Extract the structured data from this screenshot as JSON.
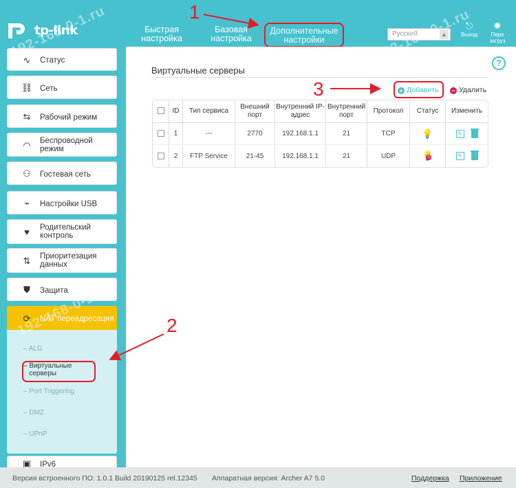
{
  "header": {
    "logo_text": "tp-link",
    "tabs": [
      {
        "label_line1": "Быстрая",
        "label_line2": "настройка"
      },
      {
        "label_line1": "Базовая",
        "label_line2": "настройка"
      },
      {
        "label_line1": "Дополнительные",
        "label_line2": "настройки"
      }
    ],
    "language": "Русский",
    "logout_label": "Выход",
    "reboot_label_line1": "Пере",
    "reboot_label_line2": "загруз"
  },
  "sidebar": {
    "items": [
      {
        "label": "Статус",
        "icon": "pulse-icon"
      },
      {
        "label": "Сеть",
        "icon": "network-icon"
      },
      {
        "label": "Рабочий режим",
        "icon": "mode-icon"
      },
      {
        "label_line1": "Беспроводной",
        "label_line2": "режим",
        "icon": "wifi-icon"
      },
      {
        "label": "Гостевая сеть",
        "icon": "guest-icon"
      },
      {
        "label": "Настройки USB",
        "icon": "usb-icon"
      },
      {
        "label_line1": "Родительский",
        "label_line2": "контроль",
        "icon": "heart-icon"
      },
      {
        "label_line1": "Приоритезация",
        "label_line2": "данных",
        "icon": "priority-icon"
      },
      {
        "label": "Защита",
        "icon": "shield-icon"
      },
      {
        "label": "NAT переадресация",
        "icon": "nat-icon"
      },
      {
        "label": "IPv6",
        "icon": "ipv6-icon"
      }
    ],
    "submenu": [
      {
        "label": "ALG"
      },
      {
        "label_line1": "Виртуальные",
        "label_line2": "серверы"
      },
      {
        "label": "Port Triggering"
      },
      {
        "label": "DMZ"
      },
      {
        "label": "UPnP"
      }
    ]
  },
  "main": {
    "title": "Виртуальные серверы",
    "add_label": "Добавить",
    "delete_label": "Удалить",
    "table": {
      "headers": [
        "ID",
        "Тип сервиса",
        "Внешний порт",
        "Внутренний IP-адрес",
        "Внутренний порт",
        "Протокол",
        "Статус",
        "Изменить"
      ],
      "header_lines": {
        "external_port": [
          "Внешний",
          "порт"
        ],
        "internal_ip": [
          "Внутренний IP-",
          "адрес"
        ],
        "internal_port": [
          "Внутренний",
          "порт"
        ]
      },
      "rows": [
        {
          "id": "1",
          "service": "---",
          "ext_port": "2770",
          "ip": "192.168.1.1",
          "int_port": "21",
          "protocol": "TCP",
          "status": "enabled"
        },
        {
          "id": "2",
          "service": "FTP Service",
          "ext_port": "21-45",
          "ip": "192.168.1.1",
          "int_port": "21",
          "protocol": "UDP",
          "status": "disabled"
        }
      ]
    }
  },
  "footer": {
    "firmware": "Версия встроенного ПО: 1.0.1 Build 20190125 rel.12345",
    "hardware": "Аппаратная версия: Archer A7 5.0",
    "support": "Поддержка",
    "app": "Приложение"
  },
  "annotations": {
    "n1": "1",
    "n2": "2",
    "n3": "3",
    "watermark": "192-168-0-1.ru"
  },
  "colors": {
    "accent": "#47c1cd",
    "active": "#f5c100",
    "annotation": "#e21d2a"
  }
}
